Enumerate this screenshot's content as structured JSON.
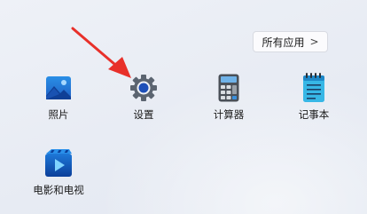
{
  "header": {
    "all_apps_label": "所有应用",
    "all_apps_chevron": ">"
  },
  "apps": [
    {
      "label": "照片",
      "icon": "photos-icon"
    },
    {
      "label": "设置",
      "icon": "gear-icon"
    },
    {
      "label": "计算器",
      "icon": "calculator-icon"
    },
    {
      "label": "记事本",
      "icon": "notepad-icon"
    },
    {
      "label": "电影和电视",
      "icon": "movies-tv-icon"
    }
  ],
  "annotation": {
    "color": "#e8302a",
    "icon": "red-arrow-icon"
  }
}
